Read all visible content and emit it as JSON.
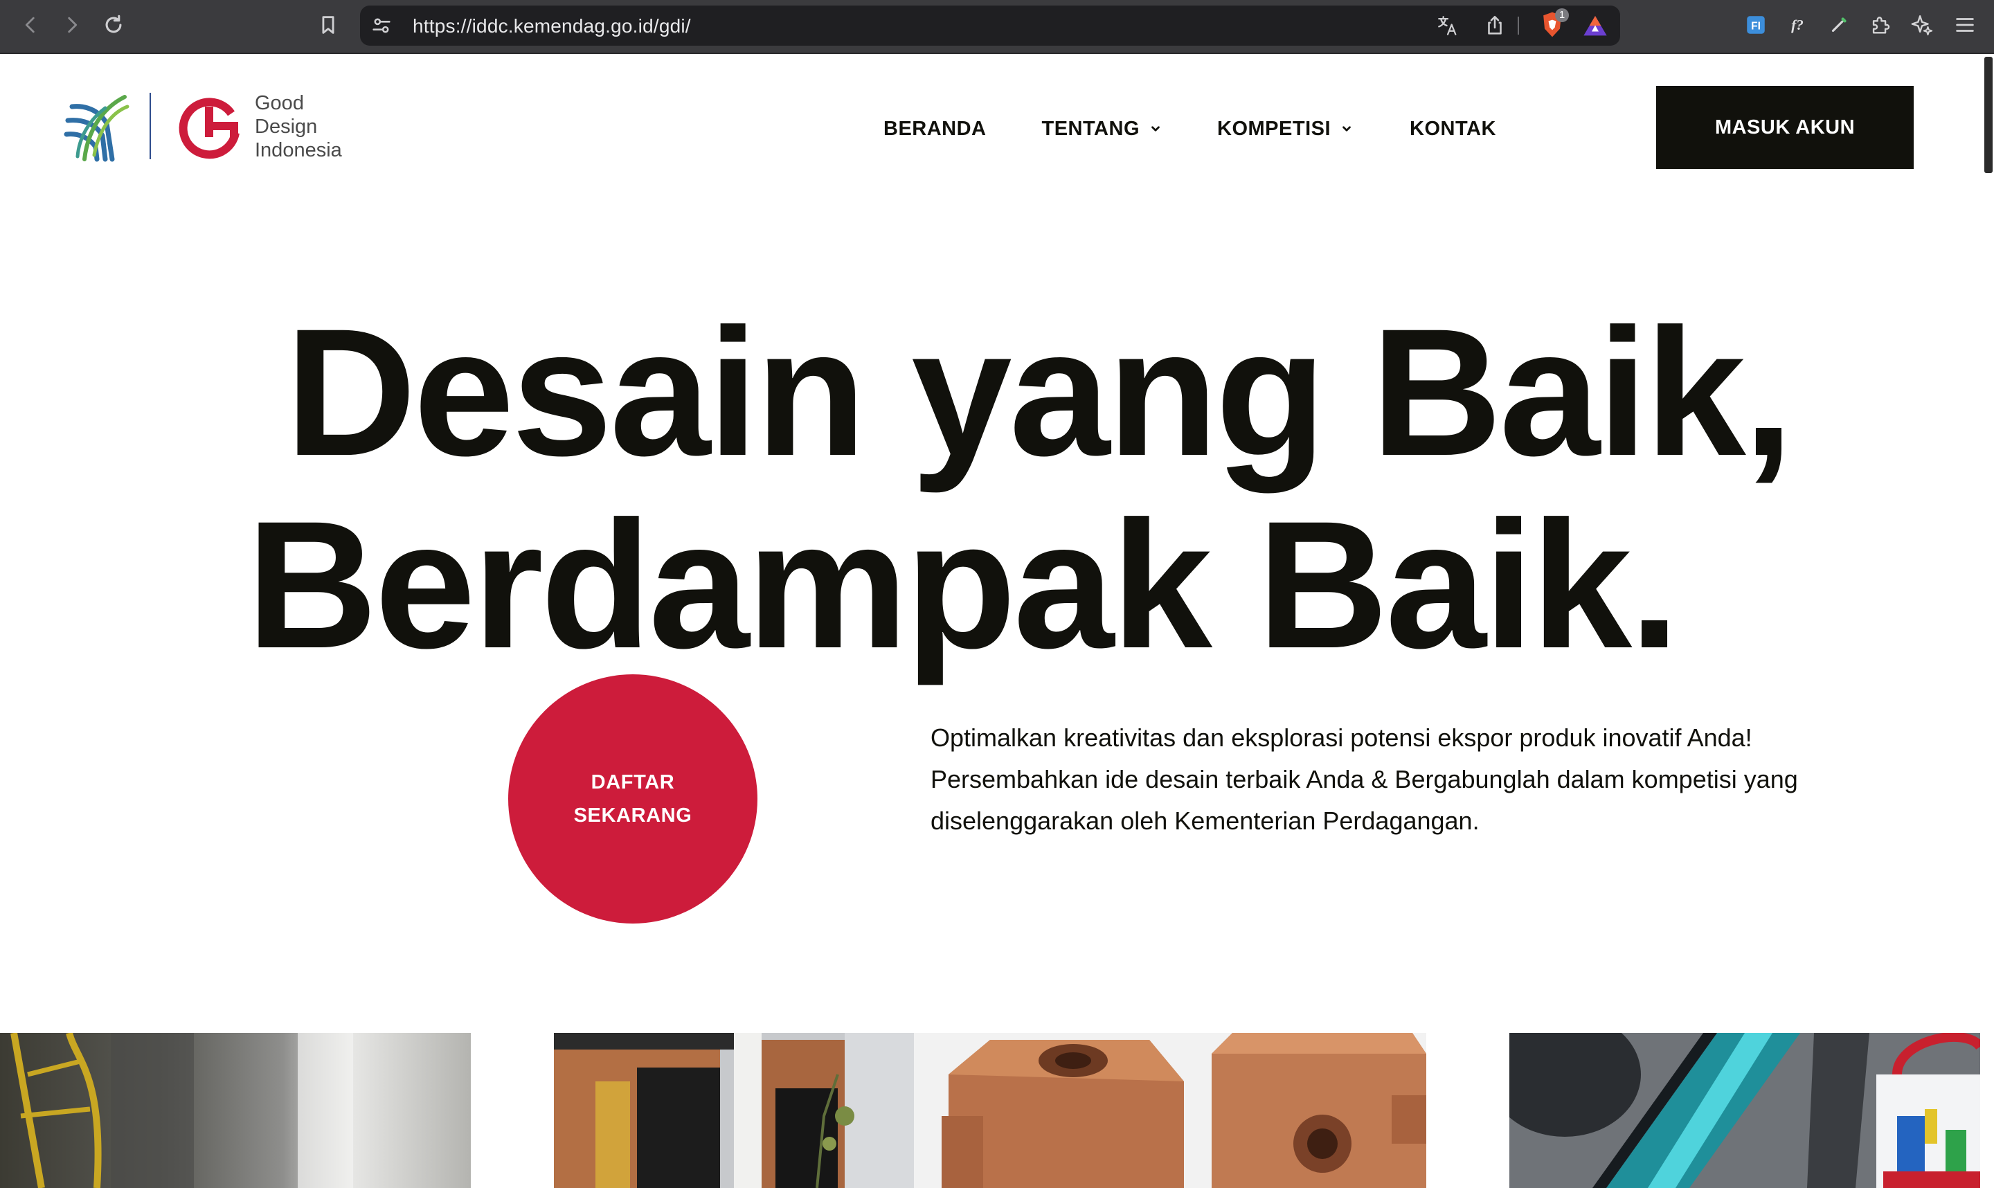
{
  "browser": {
    "url": "https://iddc.kemendag.go.id/gdi/",
    "brave_shield_count": "1",
    "extensions": {
      "fi_label": "FI",
      "f_label": "f?"
    }
  },
  "header": {
    "logo_text": [
      "Good",
      "Design",
      "Indonesia"
    ],
    "nav": {
      "beranda": "BERANDA",
      "tentang": "TENTANG",
      "kompetisi": "KOMPETISI",
      "kontak": "KONTAK"
    },
    "login_label": "MASUK AKUN"
  },
  "hero": {
    "headline_line1": "Desain yang Baik,",
    "headline_line2": "Berdampak Baik.",
    "cta_line1": "DAFTAR",
    "cta_line2": "SEKARANG",
    "description": "Optimalkan kreativitas dan eksplorasi potensi ekspor produk inovatif Anda! Persembahkan ide desain terbaik Anda & Bergabunglah dalam kompetisi yang diselenggarakan oleh Kementerian Perdagangan."
  },
  "colors": {
    "brand_red": "#cd1c3b",
    "ink": "#11110c",
    "chrome_bg": "#3b3b3e"
  },
  "icons": {
    "back": "chevron-left-icon",
    "forward": "chevron-right-icon",
    "reload": "reload-icon",
    "bookmark": "bookmark-icon",
    "site_settings": "tune-icon",
    "translate": "translate-icon",
    "share": "share-icon",
    "brave": "brave-shield-icon",
    "rewards": "brave-rewards-icon",
    "extensions": "puzzle-icon",
    "leo": "sparkle-icon",
    "menu": "hamburger-menu-icon"
  }
}
